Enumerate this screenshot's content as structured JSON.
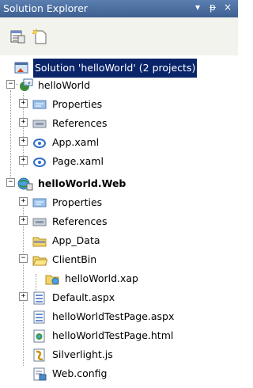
{
  "titlebar": {
    "title": "Solution Explorer",
    "dropdown": "▾",
    "pin": "ᵽ",
    "close": "×"
  },
  "tree": {
    "solution": "Solution 'helloWorld' (2 projects)",
    "project1": "helloWorld",
    "p1_items": [
      "Properties",
      "References",
      "App.xaml",
      "Page.xaml"
    ],
    "project2": "helloWorld.Web",
    "p2_items": [
      "Properties",
      "References",
      "App_Data",
      "ClientBin"
    ],
    "clientbin_child": "helloWorld.xap",
    "p2_items_after": [
      "Default.aspx",
      "helloWorldTestPage.aspx",
      "helloWorldTestPage.html",
      "Silverlight.js",
      "Web.config"
    ]
  },
  "colors": {
    "selection": "#0a246a",
    "titlebar": "#3e5f91"
  }
}
